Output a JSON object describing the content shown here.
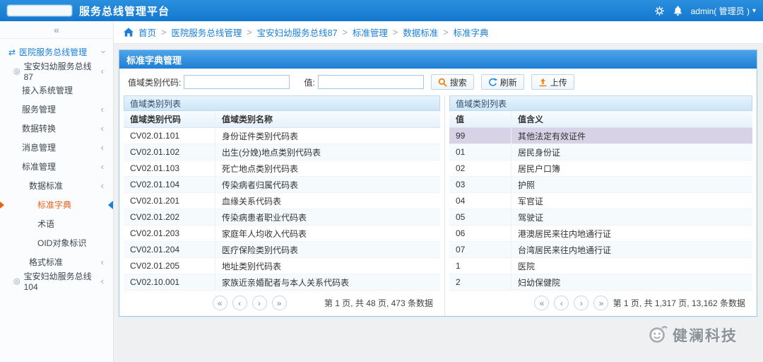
{
  "colors": {
    "accent": "#1a80d8",
    "active_item": "#e8621a",
    "selected_row": "#d8d2e6"
  },
  "header": {
    "title": "服务总线管理平台",
    "user_label": "admin( 管理员 )",
    "caret": "▾"
  },
  "sidebar": {
    "collapse_glyph": "«",
    "items": [
      {
        "label": "医院服务总线管理",
        "level": 0,
        "prefix": "⇄",
        "chev": "‹",
        "expanded": true
      },
      {
        "label": "宝安妇幼服务总线87",
        "level": 1,
        "prefix": "◎",
        "chev": "‹"
      },
      {
        "label": "接入系统管理",
        "level": 2,
        "prefix": "",
        "chev": ""
      },
      {
        "label": "服务管理",
        "level": 2,
        "prefix": "",
        "chev": "‹"
      },
      {
        "label": "数据转换",
        "level": 2,
        "prefix": "",
        "chev": "‹"
      },
      {
        "label": "消息管理",
        "level": 2,
        "prefix": "",
        "chev": "‹"
      },
      {
        "label": "标准管理",
        "level": 2,
        "prefix": "",
        "chev": "‹"
      },
      {
        "label": "数据标准",
        "level": 3,
        "prefix": "",
        "chev": "‹"
      },
      {
        "label": "标准字典",
        "level": 4,
        "prefix": "",
        "chev": "",
        "active": true
      },
      {
        "label": "术语",
        "level": 4,
        "prefix": "",
        "chev": ""
      },
      {
        "label": "OID对象标识",
        "level": 4,
        "prefix": "",
        "chev": ""
      },
      {
        "label": "格式标准",
        "level": 3,
        "prefix": "",
        "chev": "‹"
      },
      {
        "label": "宝安妇幼服务总线104",
        "level": 1,
        "prefix": "◎",
        "chev": "‹"
      }
    ]
  },
  "breadcrumb": {
    "items": [
      {
        "sep": "",
        "label": "首页"
      },
      {
        "sep": ">",
        "label": "医院服务总线管理"
      },
      {
        "sep": ">",
        "label": "宝安妇幼服务总线87"
      },
      {
        "sep": ">",
        "label": "标准管理"
      },
      {
        "sep": ">",
        "label": "数据标准"
      },
      {
        "sep": ">",
        "label": "标准字典"
      }
    ]
  },
  "panel": {
    "title": "标准字典管理"
  },
  "filters": {
    "code_label": "值域类别代码:",
    "code_value": "",
    "value_label": "值:",
    "value_value": "",
    "search_label": "搜索",
    "refresh_label": "刷新",
    "upload_label": "上传"
  },
  "left_table": {
    "section_title": "值域类别列表",
    "columns": [
      "值域类别代码",
      "值域类别名称"
    ],
    "rows": [
      {
        "code": "CV02.01.101",
        "name": "身份证件类别代码表"
      },
      {
        "code": "CV02.01.102",
        "name": "出生(分娩)地点类别代码表"
      },
      {
        "code": "CV02.01.103",
        "name": "死亡地点类别代码表"
      },
      {
        "code": "CV02.01.104",
        "name": "传染病者归属代码表"
      },
      {
        "code": "CV02.01.201",
        "name": "血缘关系代码表"
      },
      {
        "code": "CV02.01.202",
        "name": "传染病患者职业代码表"
      },
      {
        "code": "CV02.01.203",
        "name": "家庭年人均收入代码表"
      },
      {
        "code": "CV02.01.204",
        "name": "医疗保险类别代码表"
      },
      {
        "code": "CV02.01.205",
        "name": "地址类别代码表"
      },
      {
        "code": "CV02.10.001",
        "name": "家族近亲婚配者与本人关系代码表"
      }
    ],
    "pagination": {
      "buttons": [
        "«",
        "‹",
        "›",
        "»"
      ],
      "info": "第 1 页, 共 48 页,  473 条数据"
    }
  },
  "right_table": {
    "section_title": "值域类别列表",
    "columns": [
      "值",
      "值含义"
    ],
    "rows": [
      {
        "value": "99",
        "meaning": "其他法定有效证件",
        "selected": true
      },
      {
        "value": "01",
        "meaning": "居民身份证"
      },
      {
        "value": "02",
        "meaning": "居民户口簿"
      },
      {
        "value": "03",
        "meaning": "护照"
      },
      {
        "value": "04",
        "meaning": "军官证"
      },
      {
        "value": "05",
        "meaning": "驾驶证"
      },
      {
        "value": "06",
        "meaning": "港澳居民来往内地通行证"
      },
      {
        "value": "07",
        "meaning": "台湾居民来往内地通行证"
      },
      {
        "value": "1",
        "meaning": "医院"
      },
      {
        "value": "2",
        "meaning": "妇幼保健院"
      }
    ],
    "pagination": {
      "buttons": [
        "«",
        "‹",
        "›",
        "»"
      ],
      "info": "第 1 页, 共 1,317 页,  13,162 条数据"
    }
  },
  "watermark": "健澜科技"
}
